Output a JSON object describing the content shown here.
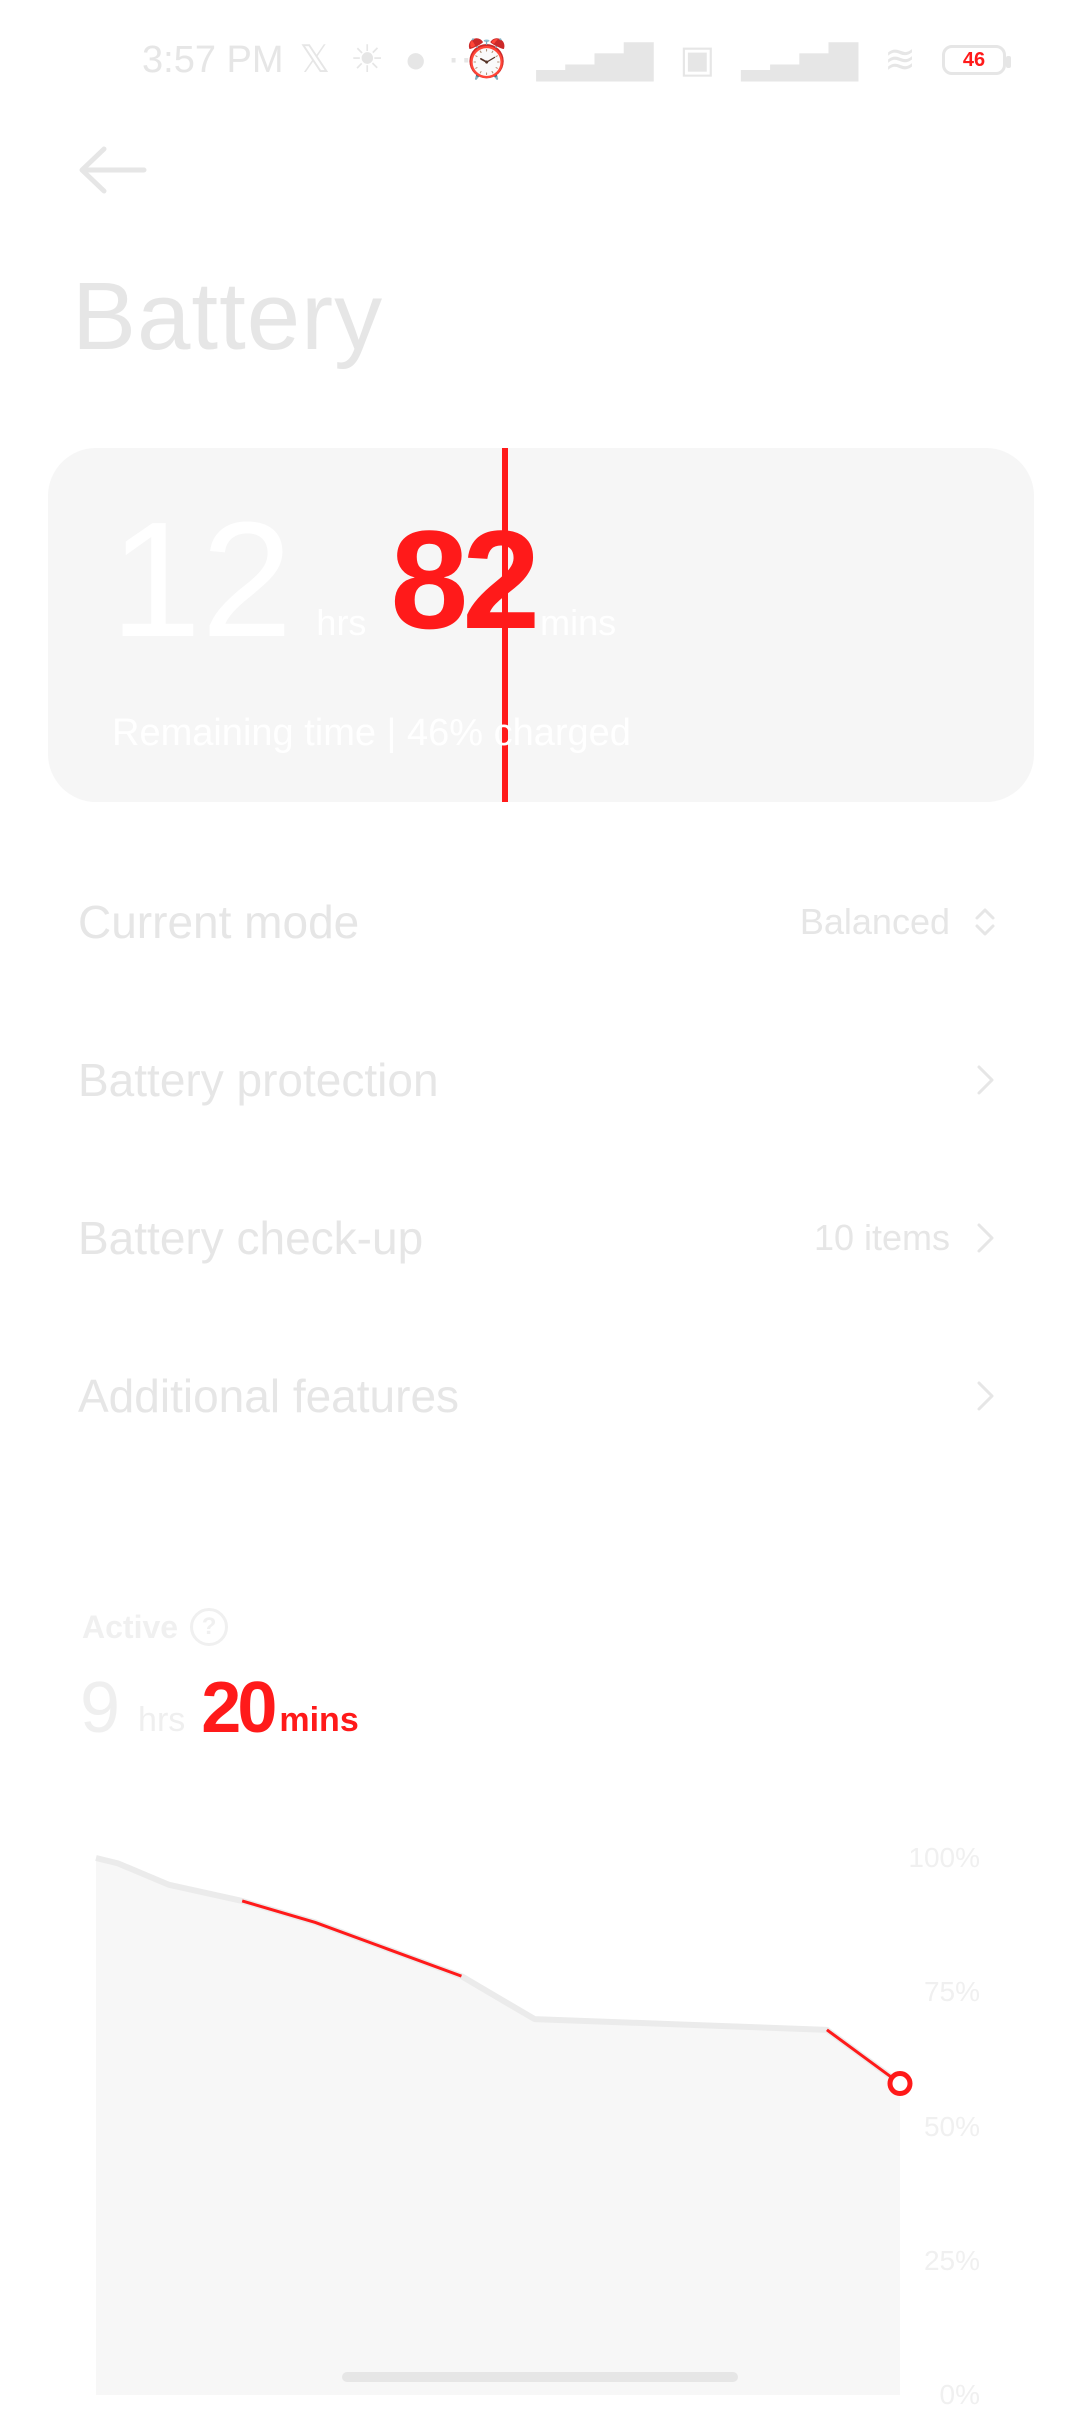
{
  "status_bar": {
    "time": "3:57 PM",
    "icons_left": [
      "x-icon",
      "sunrise-icon",
      "chat-icon",
      "more-icon"
    ],
    "icons_right": [
      "alarm-icon",
      "signal-icon",
      "volte-icon",
      "signal-icon",
      "wifi-icon"
    ],
    "battery_level": "46"
  },
  "header": {
    "title": "Battery"
  },
  "summary": {
    "hours_value": "12",
    "hours_unit": "hrs",
    "minutes_value": "82",
    "minutes_unit": "mins",
    "remaining_text": "Remaining time | 46% charged"
  },
  "settings": [
    {
      "label": "Current mode",
      "value": "Balanced",
      "icon": "updown-icon"
    },
    {
      "label": "Battery protection",
      "value": "",
      "icon": "chevron-right-icon"
    },
    {
      "label": "Battery check-up",
      "value": "10 items",
      "icon": "chevron-right-icon"
    },
    {
      "label": "Additional features",
      "value": "",
      "icon": "chevron-right-icon"
    }
  ],
  "active": {
    "label": "Active",
    "hours_value": "9",
    "hours_unit": "hrs",
    "minutes_value": "20",
    "minutes_unit": "mins"
  },
  "chart_data": {
    "type": "area",
    "y_ticks": [
      "100%",
      "75%",
      "50%",
      "25%",
      "0%"
    ],
    "ylim": [
      0,
      100
    ],
    "xlim": [
      0,
      11
    ],
    "series": [
      {
        "x": [
          0,
          0.3,
          1,
          2,
          3,
          4,
          5,
          6,
          8,
          10,
          11
        ],
        "values": [
          100,
          99,
          95,
          92,
          88,
          83,
          78,
          70,
          69,
          68,
          58
        ]
      }
    ],
    "grid": false,
    "colors": {
      "line": "#ebebeb",
      "fill": "#f7f7f7",
      "highlight": "#ff1a1a",
      "dot": "#ff1a1a"
    }
  }
}
